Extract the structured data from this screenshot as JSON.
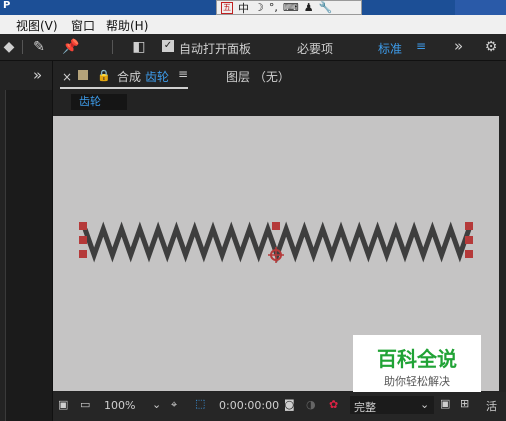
{
  "titlebar": {
    "app_letter": "P"
  },
  "ime": {
    "box": "五",
    "lang": "中",
    "moon": "☽",
    "dots": "°,",
    "keyboard": "⌨",
    "person": "♟",
    "tool": "🔧"
  },
  "menu": {
    "view": "视图(V)",
    "window": "窗口",
    "help": "帮助(H)"
  },
  "toolbar": {
    "auto_open": "自动打开面板",
    "essential": "必要项",
    "standard": "标准",
    "more": "»"
  },
  "left_panel": {
    "expand": "»"
  },
  "comp_tab": {
    "close": "×",
    "comp_label": "合成",
    "comp_name": "齿轮",
    "menu": "≡",
    "layer_label": "图层 （无）",
    "breadcrumb": "齿轮"
  },
  "bottom_bar": {
    "zoom": "100%",
    "timecode": "0:00:00:00",
    "resolution": "完整",
    "trailing": "活"
  },
  "shape_text": "VVVVVVVVVVVVVVVVVVVVV",
  "watermark": {
    "title": "百科全说",
    "subtitle": "助你轻松解决"
  },
  "colors": {
    "accent": "#3d9be9",
    "viewer_bg": "#c5c4c4",
    "handle": "#b53a3a",
    "zigzag": "#3e3e3e"
  }
}
